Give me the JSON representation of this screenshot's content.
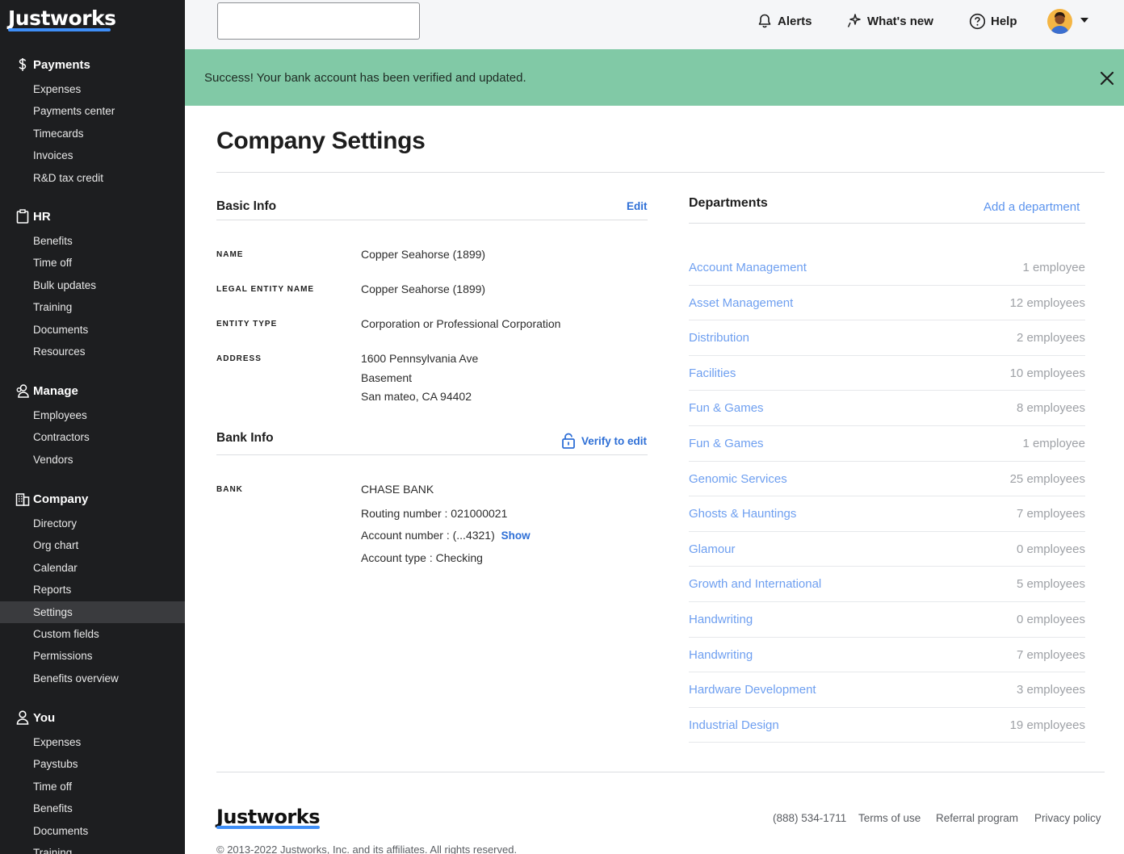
{
  "brand": "Justworks",
  "sidebar": {
    "sections": [
      {
        "title": "Payments",
        "icon": "dollar-icon",
        "items": [
          "Expenses",
          "Payments center",
          "Timecards",
          "Invoices",
          "R&D tax credit"
        ]
      },
      {
        "title": "HR",
        "icon": "clipboard-icon",
        "items": [
          "Benefits",
          "Time off",
          "Bulk updates",
          "Training",
          "Documents",
          "Resources"
        ]
      },
      {
        "title": "Manage",
        "icon": "people-icon",
        "items": [
          "Employees",
          "Contractors",
          "Vendors"
        ]
      },
      {
        "title": "Company",
        "icon": "building-icon",
        "items": [
          "Directory",
          "Org chart",
          "Calendar",
          "Reports",
          "Settings",
          "Custom fields",
          "Permissions",
          "Benefits overview"
        ]
      },
      {
        "title": "You",
        "icon": "user-icon",
        "items": [
          "Expenses",
          "Paystubs",
          "Time off",
          "Benefits",
          "Documents",
          "Training"
        ]
      }
    ],
    "active_item": "Settings"
  },
  "topbar": {
    "search_placeholder": "",
    "alerts": "Alerts",
    "whats_new": "What's new",
    "help": "Help"
  },
  "banner": {
    "message": "Success! Your bank account has been verified and updated."
  },
  "page": {
    "title": "Company Settings"
  },
  "basic_info": {
    "title": "Basic Info",
    "edit": "Edit",
    "name_label": "NAME",
    "name": "Copper Seahorse (1899)",
    "legal_label": "LEGAL ENTITY NAME",
    "legal": "Copper Seahorse (1899)",
    "entity_label": "ENTITY TYPE",
    "entity": "Corporation or Professional Corporation",
    "address_label": "ADDRESS",
    "address_line1": "1600 Pennsylvania Ave",
    "address_line2": "Basement",
    "address_line3": "San mateo, CA 94402"
  },
  "bank_info": {
    "title": "Bank Info",
    "verify": "Verify to edit",
    "bank_label": "BANK",
    "bank_name": "CHASE BANK",
    "routing": "Routing number : 021000021",
    "account": "Account number : (...4321)",
    "show": "Show",
    "account_type": "Account type : Checking"
  },
  "departments": {
    "title": "Departments",
    "add": "Add a department",
    "rows": [
      {
        "name": "Account Management",
        "count": "1 employee"
      },
      {
        "name": "Asset Management",
        "count": "12 employees"
      },
      {
        "name": "Distribution",
        "count": "2 employees"
      },
      {
        "name": "Facilities",
        "count": "10 employees"
      },
      {
        "name": "Fun & Games",
        "count": "8 employees"
      },
      {
        "name": "Fun & Games",
        "count": "1 employee"
      },
      {
        "name": "Genomic Services",
        "count": "25 employees"
      },
      {
        "name": "Ghosts & Hauntings",
        "count": "7 employees"
      },
      {
        "name": "Glamour",
        "count": "0 employees"
      },
      {
        "name": "Growth and International",
        "count": "5 employees"
      },
      {
        "name": "Handwriting",
        "count": "0 employees"
      },
      {
        "name": "Handwriting",
        "count": "7 employees"
      },
      {
        "name": "Hardware Development",
        "count": "3 employees"
      },
      {
        "name": "Industrial Design",
        "count": "19 employees"
      }
    ]
  },
  "footer": {
    "phone": "(888) 534-1711",
    "terms": "Terms of use",
    "referral": "Referral program",
    "privacy": "Privacy policy",
    "copyright": "© 2013-2022 Justworks, Inc. and its affiliates. All rights reserved."
  }
}
